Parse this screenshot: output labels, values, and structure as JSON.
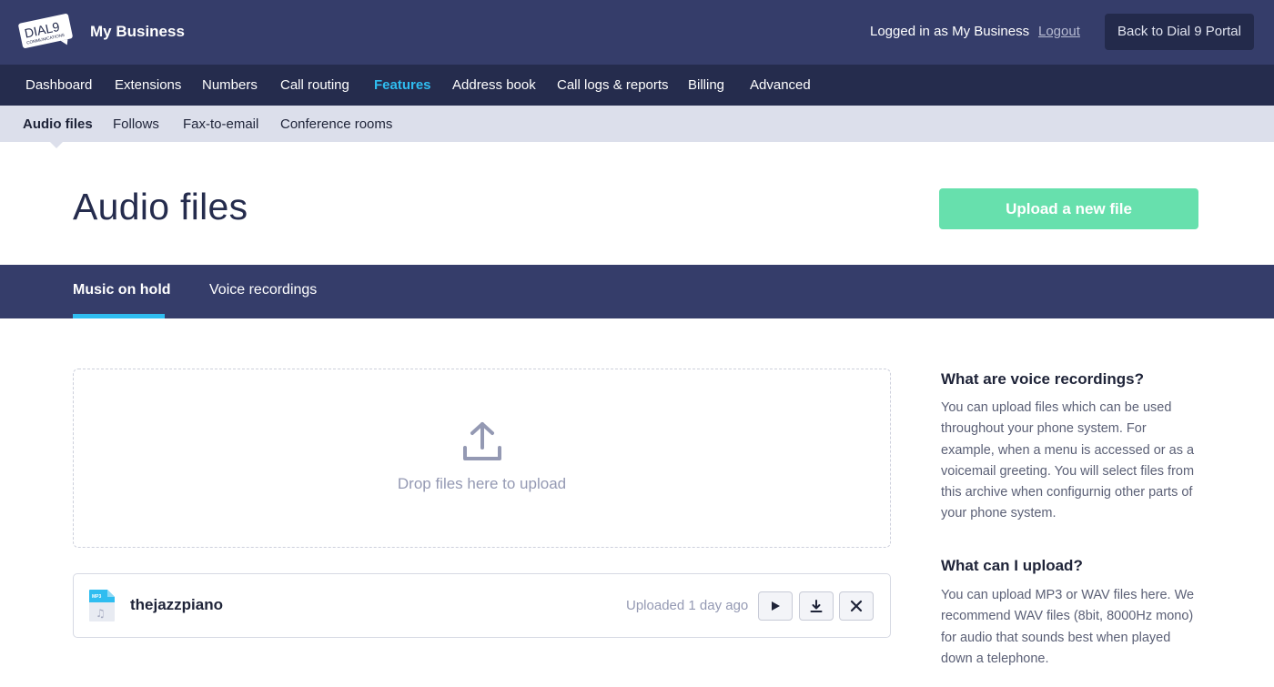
{
  "topbar": {
    "logo_text": "DIAL9",
    "logo_sub": "COMMUNICATIONS",
    "brand": "My Business",
    "logged_in": "Logged in as My Business",
    "logout": "Logout",
    "portal_button": "Back to Dial 9 Portal"
  },
  "main_nav": {
    "items": [
      "Dashboard",
      "Extensions",
      "Numbers",
      "Call routing",
      "Features",
      "Address book",
      "Call logs & reports",
      "Billing",
      "Advanced"
    ],
    "active": "Features"
  },
  "sub_nav": {
    "items": [
      "Audio files",
      "Follows",
      "Fax-to-email",
      "Conference rooms"
    ],
    "active": "Audio files"
  },
  "page": {
    "title": "Audio files",
    "upload_button": "Upload a new file"
  },
  "tabs": {
    "items": [
      "Music on hold",
      "Voice recordings"
    ],
    "active": "Music on hold"
  },
  "dropzone": {
    "text": "Drop files here to upload"
  },
  "files": [
    {
      "name": "thejazzpiano",
      "type_badge": "MP3",
      "uploaded": "Uploaded 1 day ago"
    }
  ],
  "sidebar": {
    "sections": [
      {
        "heading": "What are voice recordings?",
        "lines": [
          "You can upload files which can be used",
          "throughout your phone system. For",
          "example, when a menu is accessed or as a",
          "voicemail greeting. You will select files from",
          "this archive when configurnig other parts of",
          "your phone system."
        ]
      },
      {
        "heading": "What can I upload?",
        "lines": [
          "You can upload MP3 or WAV files here. We",
          "recommend WAV files (8bit, 8000Hz mono)",
          "for audio that sounds best when played",
          "down a telephone."
        ]
      }
    ]
  },
  "colors": {
    "header_bg": "#353d6a",
    "nav_bg": "#252c4d",
    "subnav_bg": "#dcdfeb",
    "accent": "#2fbdf0",
    "upload_green": "#67e0ad"
  }
}
